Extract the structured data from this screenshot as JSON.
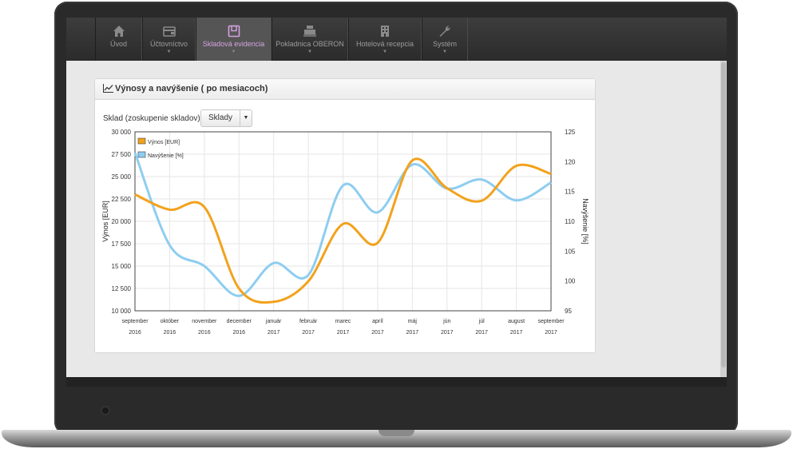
{
  "nav": {
    "items": [
      {
        "label": "Úvod",
        "icon": "home-icon",
        "caret": false,
        "active": false
      },
      {
        "label": "Účtovníctvo",
        "icon": "wallet-icon",
        "caret": true,
        "active": false
      },
      {
        "label": "Skladová evidencia",
        "icon": "warehouse-icon",
        "caret": true,
        "active": true
      },
      {
        "label": "Pokladnica OBERON",
        "icon": "cash-register-icon",
        "caret": true,
        "active": false
      },
      {
        "label": "Hotelová recepcia",
        "icon": "hotel-icon",
        "caret": true,
        "active": false
      },
      {
        "label": "Systém",
        "icon": "wrench-icon",
        "caret": true,
        "active": false
      }
    ]
  },
  "panel": {
    "title": "Výnosy a navýšenie ( po mesiacoch)",
    "filter_label": "Sklad (zoskupenie skladov):",
    "dropdown_value": "Sklady"
  },
  "colors": {
    "revenue": "#f2a21d",
    "markup": "#8ecdf0",
    "active_nav": "#d4a2e0"
  },
  "chart_data": {
    "type": "line",
    "categories": [
      [
        "september",
        "2016"
      ],
      [
        "október",
        "2016"
      ],
      [
        "november",
        "2016"
      ],
      [
        "december",
        "2016"
      ],
      [
        "január",
        "2017"
      ],
      [
        "február",
        "2017"
      ],
      [
        "marec",
        "2017"
      ],
      [
        "apríl",
        "2017"
      ],
      [
        "máj",
        "2017"
      ],
      [
        "jún",
        "2017"
      ],
      [
        "júl",
        "2017"
      ],
      [
        "august",
        "2017"
      ],
      [
        "september",
        "2017"
      ]
    ],
    "series": [
      {
        "name": "Výnos [EUR]",
        "axis": "left",
        "color": "#f2a21d",
        "values": [
          23000,
          21300,
          21600,
          12500,
          11000,
          13300,
          19700,
          17600,
          26800,
          23700,
          22300,
          26200,
          25300
        ]
      },
      {
        "name": "Navýšenie [%]",
        "axis": "right",
        "color": "#8ecdf0",
        "values": [
          121.5,
          106,
          102.5,
          97.5,
          103,
          101,
          116,
          111.5,
          119.5,
          115.5,
          117,
          113.5,
          116.5
        ]
      }
    ],
    "ylabel_left": "Výnos [EUR]",
    "ylabel_right": "Navýšenie [%]",
    "ylim_left": [
      10000,
      30000
    ],
    "yticks_left": [
      "10 000",
      "12 500",
      "15 000",
      "17 500",
      "20 000",
      "22 500",
      "25 000",
      "27 500",
      "30 000"
    ],
    "ylim_right": [
      95,
      125
    ],
    "yticks_right": [
      "95",
      "100",
      "105",
      "110",
      "115",
      "120",
      "125"
    ],
    "grid": true,
    "legend": "top-left"
  }
}
